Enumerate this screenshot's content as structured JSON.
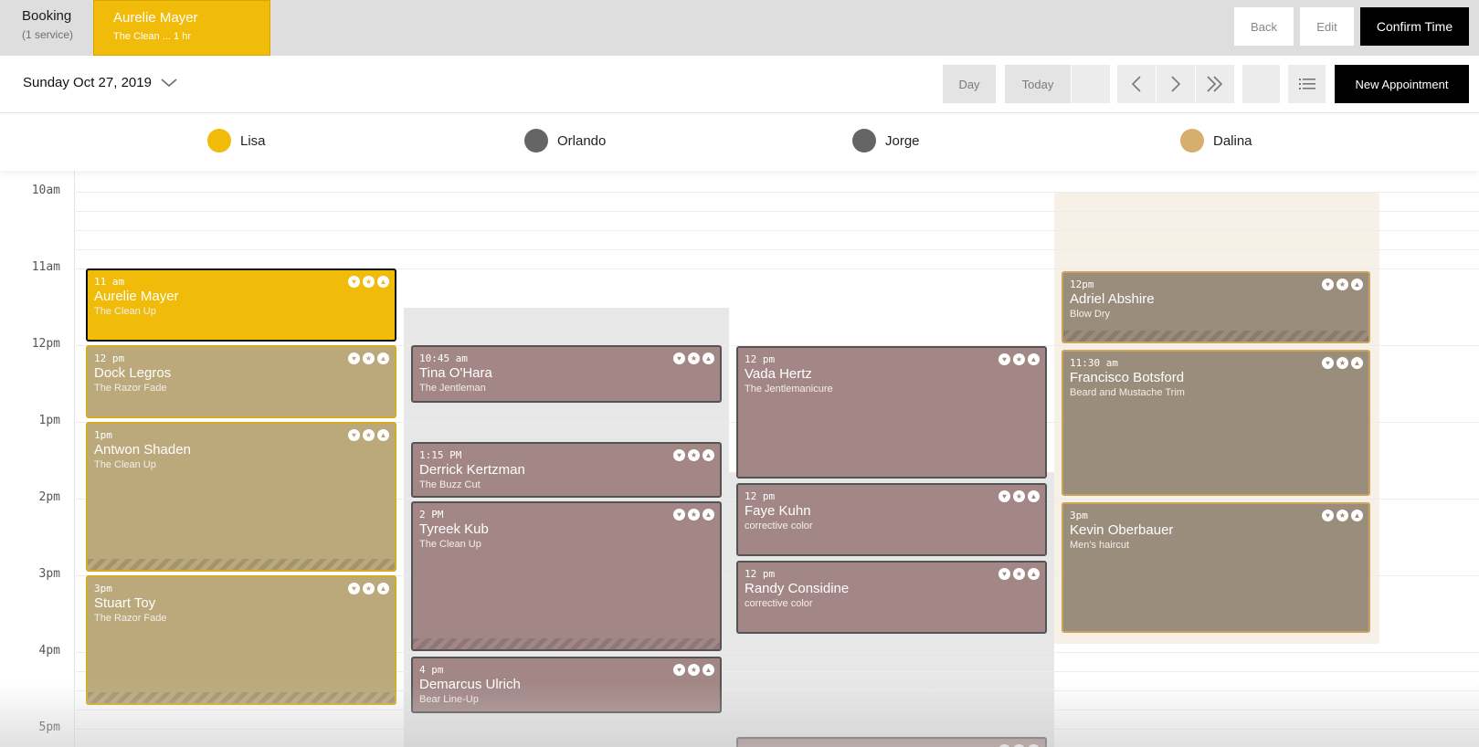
{
  "topbar": {
    "booking_title": "Booking",
    "booking_sub": "(1 service)",
    "client_name": "Aurelie Mayer",
    "client_service": "The Clean ... 1 hr",
    "back_label": "Back",
    "edit_label": "Edit",
    "confirm_label": "Confirm Time"
  },
  "toolbar": {
    "date": "Sunday Oct 27, 2019",
    "day_label": "Day",
    "today_label": "Today",
    "new_appointment_label": "New Appointment",
    "icons": [
      "chevron-left-icon",
      "chevron-right-icon",
      "double-chevron-right-icon",
      "list-icon"
    ]
  },
  "staff": [
    {
      "name": "Lisa",
      "color": "#f1bb0a"
    },
    {
      "name": "Orlando",
      "color": "#656565"
    },
    {
      "name": "Jorge",
      "color": "#656565"
    },
    {
      "name": "Dalina",
      "color": "#d6ae6e"
    }
  ],
  "times": [
    "10am",
    "11am",
    "12pm",
    "1pm",
    "2pm",
    "3pm",
    "4pm",
    "5pm"
  ],
  "columns": [
    {
      "staff": "Lisa",
      "appointments": [
        {
          "time": "11 am",
          "name": "Aurelie Mayer",
          "service": "The Clean Up",
          "style": "selected"
        },
        {
          "time": "12 pm",
          "name": "Dock Legros",
          "service": "The Razor Fade",
          "style": "booked"
        },
        {
          "time": "1pm",
          "name": "Antwon Shaden",
          "service": "The Clean Up",
          "style": "booked"
        },
        {
          "time": "3pm",
          "name": "Stuart Toy",
          "service": "The Razor Fade",
          "style": "booked"
        }
      ]
    },
    {
      "staff": "Orlando",
      "appointments": [
        {
          "time": "10:45 am",
          "name": "Tina O'Hara",
          "service": "The Jentleman",
          "style": "booked"
        },
        {
          "time": "1:15 PM",
          "name": "Derrick Kertzman",
          "service": "The Buzz Cut",
          "style": "booked"
        },
        {
          "time": "2 PM",
          "name": "Tyreek Kub",
          "service": "The Clean Up",
          "style": "booked"
        },
        {
          "time": "4 pm",
          "name": "Demarcus Ulrich",
          "service": "Bear Line-Up",
          "style": "booked"
        }
      ]
    },
    {
      "staff": "Jorge",
      "appointments": [
        {
          "time": "12 pm",
          "name": "Vada Hertz",
          "service": "The Jentlemanicure",
          "style": "booked"
        },
        {
          "time": "12 pm",
          "name": "Faye Kuhn",
          "service": "corrective color",
          "style": "booked"
        },
        {
          "time": "12 pm",
          "name": "Randy Considine",
          "service": "corrective color",
          "style": "booked"
        }
      ]
    },
    {
      "staff": "Dalina",
      "appointments": [
        {
          "time": "12pm",
          "name": "Adriel Abshire",
          "service": "Blow Dry",
          "style": "booked"
        },
        {
          "time": "11:30 am",
          "name": "Francisco Botsford",
          "service": "Beard and Mustache Trim",
          "style": "booked"
        },
        {
          "time": "3pm",
          "name": "Kevin Oberbauer",
          "service": "Men's haircut",
          "style": "booked"
        }
      ]
    }
  ],
  "appointment_icons": [
    "heart-icon",
    "star-icon",
    "thumbs-up-icon"
  ]
}
